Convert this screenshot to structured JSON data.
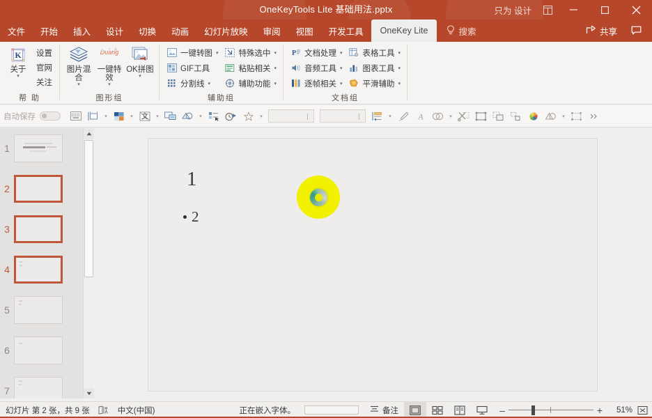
{
  "titlebar": {
    "document_title": "OneKeyTools Lite 基础用法.pptx",
    "designer_label": "只为 设计",
    "ribbon_display_icon": "ribbon-display-options-icon",
    "minimize_label": "–",
    "restore_label": "▢",
    "close_label": "✕",
    "accent_color": "#b7472a"
  },
  "tabs": [
    {
      "label": "文件",
      "active": false
    },
    {
      "label": "开始",
      "active": false
    },
    {
      "label": "插入",
      "active": false
    },
    {
      "label": "设计",
      "active": false
    },
    {
      "label": "切换",
      "active": false
    },
    {
      "label": "动画",
      "active": false
    },
    {
      "label": "幻灯片放映",
      "active": false
    },
    {
      "label": "审阅",
      "active": false
    },
    {
      "label": "视图",
      "active": false
    },
    {
      "label": "开发工具",
      "active": false
    },
    {
      "label": "OneKey Lite",
      "active": true
    }
  ],
  "search": {
    "label": "搜索",
    "icon": "lightbulb-icon"
  },
  "tabstrip_right": {
    "share_label": "共享",
    "share_icon": "share-icon",
    "comment_icon": "comment-icon"
  },
  "ribbon": {
    "groups": [
      {
        "name": "help-group",
        "label": "帮 助",
        "big_buttons": [
          {
            "label": "关于",
            "icon": "onekey-logo-icon",
            "has_dropdown": true
          }
        ],
        "text_items": [
          {
            "label": "设置"
          },
          {
            "label": "官网"
          },
          {
            "label": "关注"
          }
        ]
      },
      {
        "name": "shape-group",
        "label": "图形组",
        "big_buttons": [
          {
            "label": "图片混合",
            "icon": "layers-icon",
            "has_dropdown": true
          },
          {
            "label": "一键特效",
            "icon": "duang-icon",
            "has_dropdown": true
          },
          {
            "label": "OK拼图",
            "icon": "picture-stack-icon",
            "has_dropdown": true
          }
        ],
        "text_items": []
      },
      {
        "name": "assist-group",
        "label": "辅助组",
        "columns": [
          [
            {
              "label": "一键转图",
              "icon": "convert-image-icon",
              "has_dropdown": true
            },
            {
              "label": "GIF工具",
              "icon": "gif-icon",
              "has_dropdown": false
            },
            {
              "label": "分割线",
              "icon": "grid-icon",
              "has_dropdown": true
            }
          ],
          [
            {
              "label": "特殊选中",
              "icon": "special-select-icon",
              "has_dropdown": true
            },
            {
              "label": "粘贴相关",
              "icon": "paste-icon",
              "has_dropdown": true
            },
            {
              "label": "辅助功能",
              "icon": "accessibility-icon",
              "has_dropdown": true
            }
          ]
        ]
      },
      {
        "name": "document-group",
        "label": "文档组",
        "columns": [
          [
            {
              "label": "文档处理",
              "icon": "ppt-doc-icon",
              "has_dropdown": true
            },
            {
              "label": "音频工具",
              "icon": "audio-icon",
              "has_dropdown": true
            },
            {
              "label": "逐帧相关",
              "icon": "frames-icon",
              "has_dropdown": true
            }
          ],
          [
            {
              "label": "表格工具",
              "icon": "table-settings-icon",
              "has_dropdown": true
            },
            {
              "label": "图表工具",
              "icon": "chart-icon",
              "has_dropdown": true
            },
            {
              "label": "平滑辅助",
              "icon": "morph-icon",
              "has_dropdown": true
            }
          ]
        ]
      }
    ]
  },
  "quickbar": {
    "autosave_label": "自动保存",
    "autosave_on": false,
    "items": [
      {
        "icon": "keyboard-icon",
        "dropdown": false
      },
      {
        "icon": "align-shape-icon",
        "dropdown": true
      },
      {
        "icon": "color-swatch-icon",
        "dropdown": true
      },
      {
        "icon": "text-box-icon",
        "dropdown": true
      },
      {
        "icon": "screen-layout-icon",
        "dropdown": false
      },
      {
        "icon": "shape-merge-icon",
        "dropdown": true
      },
      {
        "icon": "selection-pane-icon",
        "dropdown": false
      },
      {
        "icon": "timing-icon",
        "dropdown": false
      },
      {
        "icon": "star-effect-icon",
        "dropdown": true
      }
    ],
    "field_one": "",
    "field_two": "",
    "items_right": [
      {
        "icon": "indent-icon",
        "dropdown": true
      },
      {
        "icon": "eyedropper-icon",
        "dropdown": false
      },
      {
        "icon": "format-painter-icon",
        "dropdown": false
      },
      {
        "icon": "shape-union-icon",
        "dropdown": true
      },
      {
        "icon": "crop-scissors-icon",
        "dropdown": false
      },
      {
        "icon": "frame-select-icon",
        "dropdown": false
      },
      {
        "icon": "duplicate-icon",
        "dropdown": false
      },
      {
        "icon": "align-objects-icon",
        "dropdown": false
      },
      {
        "icon": "color-wheel-icon",
        "dropdown": false
      },
      {
        "icon": "shape-combine-icon",
        "dropdown": true
      },
      {
        "icon": "group-shapes-icon",
        "dropdown": false
      },
      {
        "icon": "overflow-chevrons-icon",
        "dropdown": false
      }
    ]
  },
  "slidepanel": {
    "slides": [
      {
        "number": "1",
        "selected": false,
        "has_title": true
      },
      {
        "number": "2",
        "selected": true,
        "has_title": false
      },
      {
        "number": "3",
        "selected": true,
        "has_title": false
      },
      {
        "number": "4",
        "selected": true,
        "has_title": false
      },
      {
        "number": "5",
        "selected": false,
        "has_title": false
      },
      {
        "number": "6",
        "selected": false,
        "has_title": false
      },
      {
        "number": "7",
        "selected": false,
        "has_title": false
      }
    ],
    "scroll_up_icon": "scroll-up-arrow-icon",
    "scroll_down_icon": "scroll-down-arrow-icon"
  },
  "slide": {
    "heading": "1",
    "bullet_text": "2",
    "shape": {
      "name": "yellow-circle-shape",
      "fill_color": "#f2f200",
      "inner_ring_color": "#2f9f87"
    }
  },
  "statusbar": {
    "slide_count_text": "幻灯片 第 2 张，共 9 张",
    "accessibility_icon": "accessibility-check-icon",
    "language": "中文(中国)",
    "task_text": "正在嵌入字体。",
    "notes_label": "备注",
    "notes_icon": "notes-icon",
    "views": [
      {
        "icon": "normal-view-icon",
        "active": true
      },
      {
        "icon": "slide-sorter-icon",
        "active": false
      },
      {
        "icon": "reading-view-icon",
        "active": false
      },
      {
        "icon": "slideshow-icon",
        "active": false
      }
    ],
    "zoom_minus": "–",
    "zoom_plus": "+",
    "zoom_percent": "51%",
    "fit_icon": "fit-to-window-icon"
  }
}
